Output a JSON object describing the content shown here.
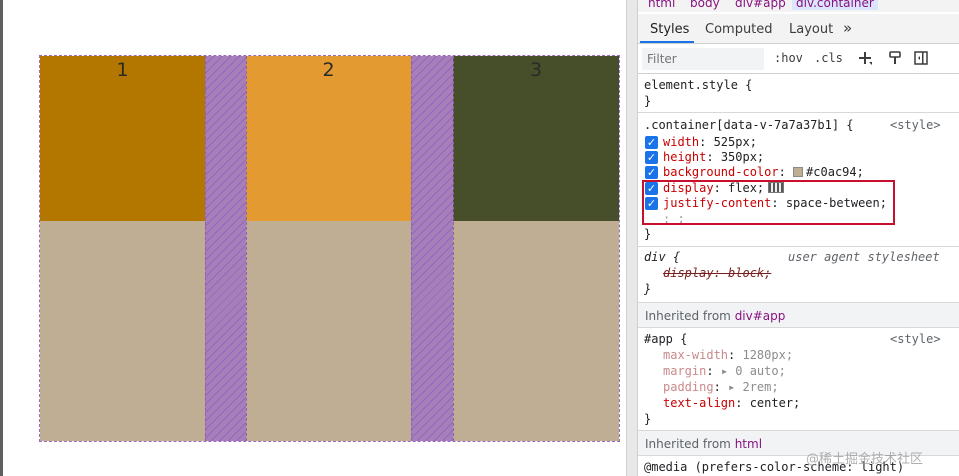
{
  "page": {
    "items": [
      {
        "label": "1",
        "color": "#b37700"
      },
      {
        "label": "2",
        "color": "#e39a30"
      },
      {
        "label": "3",
        "color": "#464f2a"
      }
    ],
    "container_color": "#c0ae94",
    "gap_color": "#a67fb8"
  },
  "devtools": {
    "breadcrumbs": [
      "html",
      "body",
      "div#app",
      "div.container"
    ],
    "tabs": [
      "Styles",
      "Computed",
      "Layout",
      "»"
    ],
    "filter_placeholder": "Filter",
    "toolbar": {
      "hov": ":hov",
      "cls": ".cls"
    },
    "element_style": {
      "selector": "element.style {",
      "close": "}"
    },
    "container_rule": {
      "selector": ".container[data-v-7a7a37b1] {",
      "source": "<style>",
      "props": [
        {
          "name": "width",
          "value": "525px;"
        },
        {
          "name": "height",
          "value": "350px;"
        },
        {
          "name": "background-color",
          "value": "#c0ac94;"
        },
        {
          "name": "display",
          "value": "flex;"
        },
        {
          "name": "justify-content",
          "value": "space-between;"
        }
      ],
      "empty_line": ": ;",
      "close": "}"
    },
    "ua_rule": {
      "selector": "div {",
      "source": "user agent stylesheet",
      "prop": "display: block;",
      "close": "}"
    },
    "inherited_app": {
      "label": "Inherited from",
      "tag": "div#app"
    },
    "app_rule": {
      "selector": "#app {",
      "source": "<style>",
      "props": [
        {
          "name": "max-width",
          "value": "1280px;"
        },
        {
          "name": "margin",
          "value": "▸ 0 auto;"
        },
        {
          "name": "padding",
          "value": "▸ 2rem;"
        },
        {
          "name": "text-align",
          "value": "center;"
        }
      ],
      "close": "}"
    },
    "inherited_html": {
      "label": "Inherited from",
      "tag": "html"
    },
    "media_rule": "@media (prefers-color-scheme: light)",
    "watermark": "@稀土掘金技术社区"
  }
}
